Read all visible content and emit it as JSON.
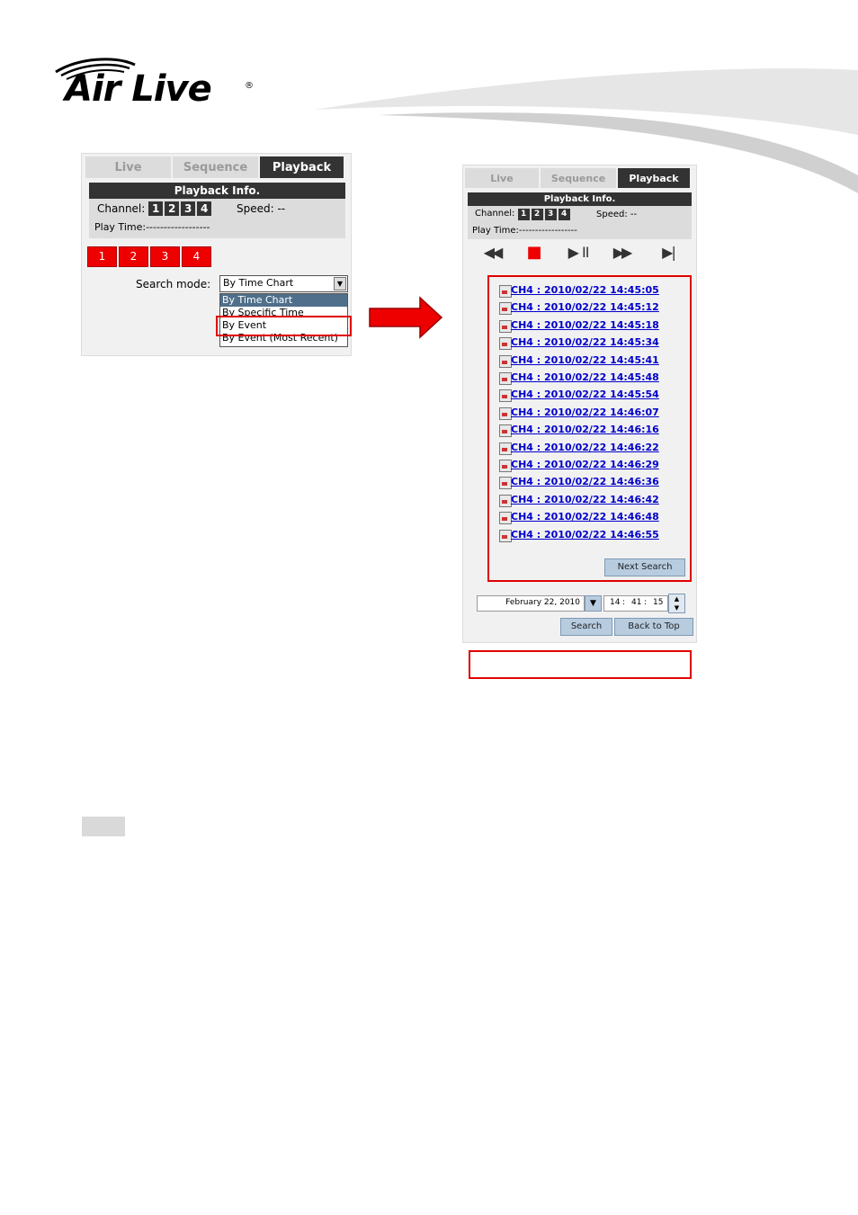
{
  "brand": {
    "logo_text": "Air Live",
    "registered": "®"
  },
  "left_panel": {
    "tabs": [
      "Live",
      "Sequence",
      "Playback"
    ],
    "info_title": "Playback Info.",
    "channel_label": "Channel:",
    "channels": [
      "1",
      "2",
      "3",
      "4"
    ],
    "speed_label": "Speed: --",
    "play_time_label": "Play Time:------------------",
    "channel_buttons": [
      "1",
      "2",
      "3",
      "4"
    ],
    "search_mode_label": "Search mode:",
    "search_mode_value": "By Time Chart",
    "options": [
      "By Time Chart",
      "By Specific Time",
      "By Event",
      "By Event (Most Recent)"
    ]
  },
  "right_panel": {
    "tabs": [
      "Live",
      "Sequence",
      "Playback"
    ],
    "info_title": "Playback Info.",
    "channel_label": "Channel:",
    "channels": [
      "1",
      "2",
      "3",
      "4"
    ],
    "speed_label": "Speed: --",
    "play_time_label": "Play Time:------------------",
    "controls": {
      "rewind": "◀◀",
      "stop": "■",
      "play_pause": "▶ II",
      "fast_forward": "▶▶",
      "next": "▶|"
    },
    "events": [
      "CH4 : 2010/02/22 14:45:05",
      "CH4 : 2010/02/22 14:45:12",
      "CH4 : 2010/02/22 14:45:18",
      "CH4 : 2010/02/22 14:45:34",
      "CH4 : 2010/02/22 14:45:41",
      "CH4 : 2010/02/22 14:45:48",
      "CH4 : 2010/02/22 14:45:54",
      "CH4 : 2010/02/22 14:46:07",
      "CH4 : 2010/02/22 14:46:16",
      "CH4 : 2010/02/22 14:46:22",
      "CH4 : 2010/02/22 14:46:29",
      "CH4 : 2010/02/22 14:46:36",
      "CH4 : 2010/02/22 14:46:42",
      "CH4 : 2010/02/22 14:46:48",
      "CH4 : 2010/02/22 14:46:55"
    ],
    "next_search_label": "Next Search",
    "date_value": "February 22, 2010",
    "hour": "14",
    "minute": "41",
    "second": "15",
    "search_label": "Search",
    "back_to_top_label": "Back to Top"
  },
  "colors": {
    "highlight": "#e00000",
    "tab_active": "#333333",
    "arrow": "#ee0000",
    "link": "#0000cc"
  }
}
